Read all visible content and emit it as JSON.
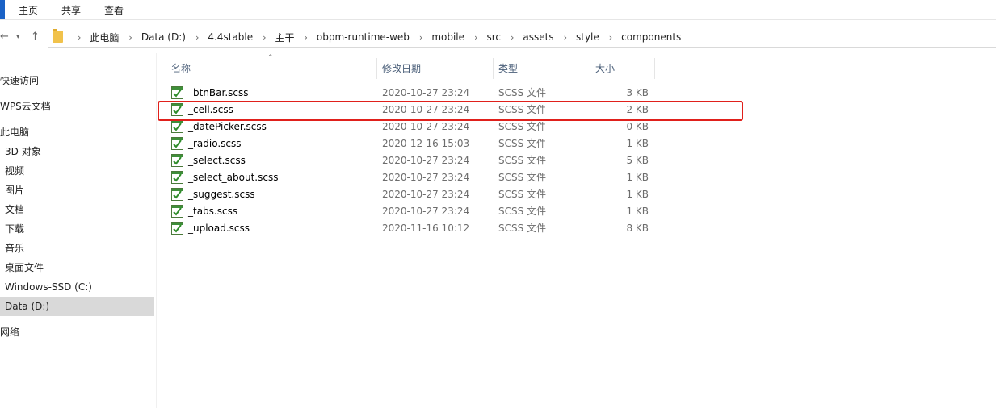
{
  "ribbon": {
    "tabs": [
      "主页",
      "共享",
      "查看"
    ]
  },
  "colors": {
    "accent": "#1a62c6",
    "highlight_border": "#e0201b",
    "selected_bg": "#d9d9d9",
    "column_header": "#4c607a"
  },
  "breadcrumb": [
    "此电脑",
    "Data (D:)",
    "4.4stable",
    "主干",
    "obpm-runtime-web",
    "mobile",
    "src",
    "assets",
    "style",
    "components"
  ],
  "sidebar": {
    "items": [
      {
        "label": "快速访问",
        "indent": false
      },
      {
        "label": "WPS云文档",
        "indent": false
      },
      {
        "label": "此电脑",
        "indent": false
      },
      {
        "label": "3D 对象",
        "indent": true
      },
      {
        "label": "视频",
        "indent": true
      },
      {
        "label": "图片",
        "indent": true
      },
      {
        "label": "文档",
        "indent": true
      },
      {
        "label": "下载",
        "indent": true
      },
      {
        "label": "音乐",
        "indent": true
      },
      {
        "label": "桌面文件",
        "indent": true
      },
      {
        "label": "Windows-SSD (C:)",
        "indent": true
      },
      {
        "label": "Data (D:)",
        "indent": true,
        "selected": true
      },
      {
        "label": "网络",
        "indent": false
      }
    ]
  },
  "columns": {
    "name": "名称",
    "date": "修改日期",
    "type": "类型",
    "size": "大小"
  },
  "files": [
    {
      "name": "_btnBar.scss",
      "date": "2020-10-27 23:24",
      "type": "SCSS 文件",
      "size": "3 KB"
    },
    {
      "name": "_cell.scss",
      "date": "2020-10-27 23:24",
      "type": "SCSS 文件",
      "size": "2 KB",
      "highlighted": true
    },
    {
      "name": "_datePicker.scss",
      "date": "2020-10-27 23:24",
      "type": "SCSS 文件",
      "size": "0 KB"
    },
    {
      "name": "_radio.scss",
      "date": "2020-12-16 15:03",
      "type": "SCSS 文件",
      "size": "1 KB"
    },
    {
      "name": "_select.scss",
      "date": "2020-10-27 23:24",
      "type": "SCSS 文件",
      "size": "5 KB"
    },
    {
      "name": "_select_about.scss",
      "date": "2020-10-27 23:24",
      "type": "SCSS 文件",
      "size": "1 KB"
    },
    {
      "name": "_suggest.scss",
      "date": "2020-10-27 23:24",
      "type": "SCSS 文件",
      "size": "1 KB"
    },
    {
      "name": "_tabs.scss",
      "date": "2020-10-27 23:24",
      "type": "SCSS 文件",
      "size": "1 KB"
    },
    {
      "name": "_upload.scss",
      "date": "2020-11-16 10:12",
      "type": "SCSS 文件",
      "size": "8 KB"
    }
  ],
  "icons": {
    "file": "scss-file-icon",
    "folder": "folder-icon",
    "back": "back-arrow-icon",
    "forward": "forward-arrow-icon",
    "up": "up-arrow-icon"
  }
}
